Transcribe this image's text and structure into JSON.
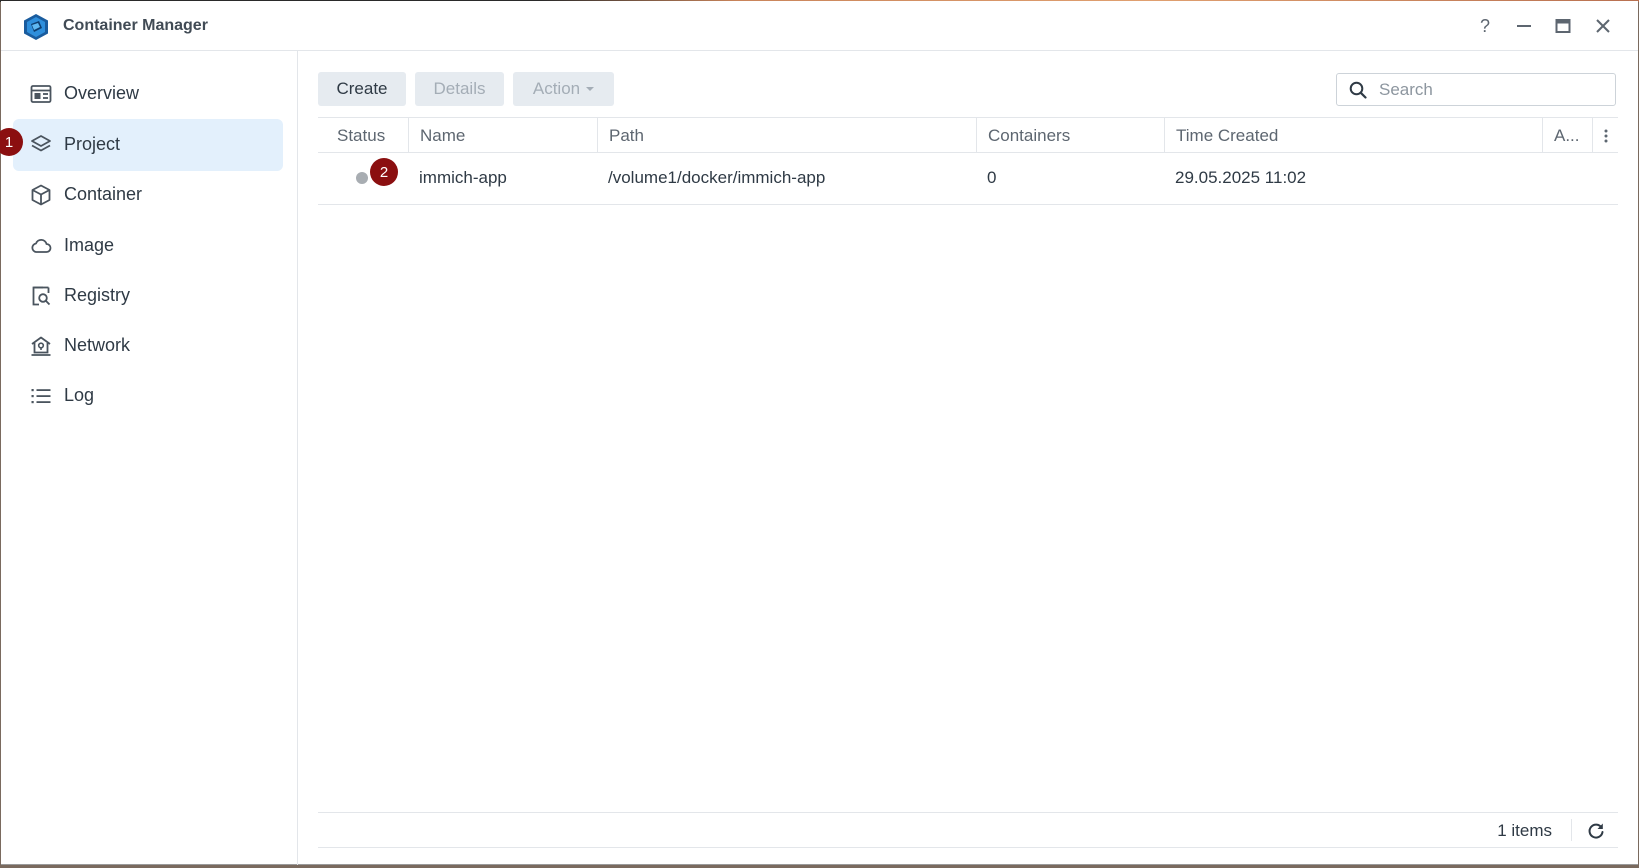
{
  "app": {
    "title": "Container Manager"
  },
  "window_controls": {
    "help": "?",
    "icons": [
      "help-icon",
      "minimize-icon",
      "maximize-icon",
      "close-icon"
    ]
  },
  "sidebar": {
    "items": [
      {
        "label": "Overview",
        "icon": "overview-icon",
        "active": false
      },
      {
        "label": "Project",
        "icon": "layers-icon",
        "active": true
      },
      {
        "label": "Container",
        "icon": "cube-icon",
        "active": false
      },
      {
        "label": "Image",
        "icon": "cloud-icon",
        "active": false
      },
      {
        "label": "Registry",
        "icon": "registry-search-icon",
        "active": false
      },
      {
        "label": "Network",
        "icon": "network-house-icon",
        "active": false
      },
      {
        "label": "Log",
        "icon": "list-icon",
        "active": false
      }
    ]
  },
  "markers": {
    "m1": "1",
    "m2": "2"
  },
  "toolbar": {
    "create_label": "Create",
    "details_label": "Details",
    "action_label": "Action"
  },
  "search": {
    "placeholder": "Search",
    "value": ""
  },
  "table": {
    "columns": [
      "Status",
      "Name",
      "Path",
      "Containers",
      "Time Created",
      "A..."
    ],
    "rows": [
      {
        "status": "stopped",
        "name": "immich-app",
        "path": "/volume1/docker/immich-app",
        "containers": "0",
        "time_created": "29.05.2025 11:02"
      }
    ]
  },
  "footer": {
    "items_count": "1 items"
  },
  "colors": {
    "active_nav_bg": "#e3f0fc",
    "marker": "#8b0f10",
    "status_stopped": "#a8adb2",
    "button_bg": "#e6ebf0"
  }
}
